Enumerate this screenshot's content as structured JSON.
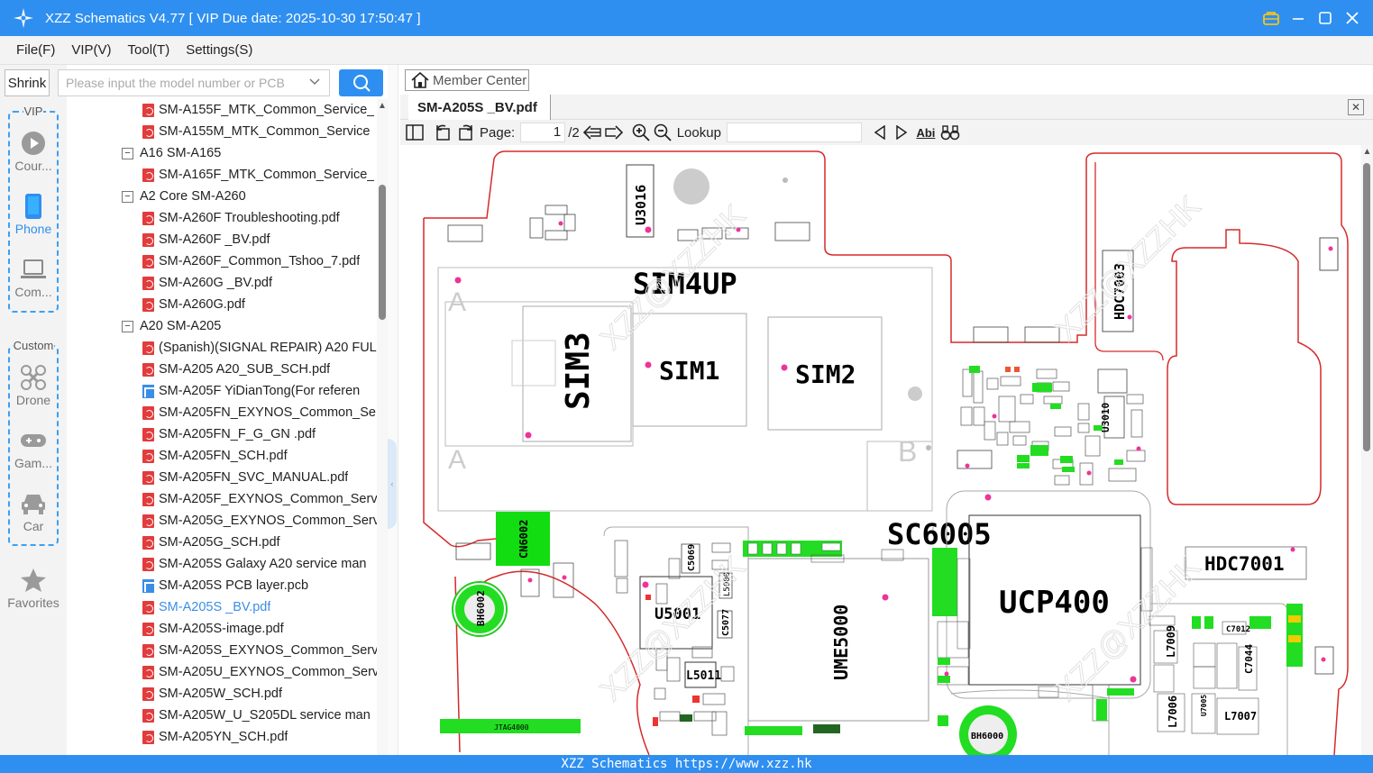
{
  "window": {
    "title": "XZZ Schematics V4.77 [ VIP Due date: 2025-10-30 17:50:47 ]"
  },
  "menu": [
    "File(F)",
    "VIP(V)",
    "Tool(T)",
    "Settings(S)"
  ],
  "left_rail": {
    "shrink_label": "Shrink",
    "vip_group_label": "VIP",
    "custom_group_label": "Custom",
    "items": [
      {
        "label": "Cour...",
        "icon": "play-icon"
      },
      {
        "label": "Phone",
        "icon": "phone-icon",
        "active": true
      },
      {
        "label": "Com...",
        "icon": "laptop-icon"
      },
      {
        "label": "Drone",
        "icon": "drone-icon"
      },
      {
        "label": "Gam...",
        "icon": "gamepad-icon"
      },
      {
        "label": "Car",
        "icon": "car-icon"
      },
      {
        "label": "Favorites",
        "icon": "star-icon"
      }
    ]
  },
  "search": {
    "placeholder": "Please input the model number or PCB"
  },
  "tree": [
    {
      "type": "pdf",
      "label": "SM-A155F_MTK_Common_Service_"
    },
    {
      "type": "pdf",
      "label": "SM-A155M_MTK_Common_Service"
    },
    {
      "type": "folder",
      "label": "A16 SM-A165"
    },
    {
      "type": "pdf",
      "label": "SM-A165F_MTK_Common_Service_"
    },
    {
      "type": "folder",
      "label": "A2 Core SM-A260"
    },
    {
      "type": "pdf",
      "label": "SM-A260F  Troubleshooting.pdf"
    },
    {
      "type": "pdf",
      "label": "SM-A260F _BV.pdf"
    },
    {
      "type": "pdf",
      "label": "SM-A260F_Common_Tshoo_7.pdf"
    },
    {
      "type": "pdf",
      "label": "SM-A260G _BV.pdf"
    },
    {
      "type": "pdf",
      "label": "SM-A260G.pdf"
    },
    {
      "type": "folder",
      "label": "A20 SM-A205"
    },
    {
      "type": "pdf",
      "label": "(Spanish)(SIGNAL REPAIR) A20 FUL"
    },
    {
      "type": "pdf",
      "label": "SM-A205 A20_SUB_SCH.pdf"
    },
    {
      "type": "pcb",
      "label": "SM-A205F YiDianTong(For referen"
    },
    {
      "type": "pdf",
      "label": "SM-A205FN_EXYNOS_Common_Se"
    },
    {
      "type": "pdf",
      "label": "SM-A205FN_F_G_GN .pdf"
    },
    {
      "type": "pdf",
      "label": "SM-A205FN_SCH.pdf"
    },
    {
      "type": "pdf",
      "label": "SM-A205FN_SVC_MANUAL.pdf"
    },
    {
      "type": "pdf",
      "label": "SM-A205F_EXYNOS_Common_Serv"
    },
    {
      "type": "pdf",
      "label": "SM-A205G_EXYNOS_Common_Serv"
    },
    {
      "type": "pdf",
      "label": "SM-A205G_SCH.pdf"
    },
    {
      "type": "pdf",
      "label": "SM-A205S Galaxy A20 service man"
    },
    {
      "type": "pcb",
      "label": "SM-A205S PCB layer.pcb"
    },
    {
      "type": "pdf",
      "label": "SM-A205S _BV.pdf",
      "selected": true
    },
    {
      "type": "pdf",
      "label": "SM-A205S-image.pdf"
    },
    {
      "type": "pdf",
      "label": "SM-A205S_EXYNOS_Common_Serv"
    },
    {
      "type": "pdf",
      "label": "SM-A205U_EXYNOS_Common_Serv"
    },
    {
      "type": "pdf",
      "label": "SM-A205W_SCH.pdf"
    },
    {
      "type": "pdf",
      "label": "SM-A205W_U_S205DL service man"
    },
    {
      "type": "pdf",
      "label": "SM-A205YN_SCH.pdf"
    }
  ],
  "viewer": {
    "member_center": "Member Center",
    "tab_title": "SM-A205S _BV.pdf",
    "page_label": "Page:",
    "page_current": "1",
    "page_total": "/2",
    "lookup_label": "Lookup",
    "abi_label": "Abi"
  },
  "board_labels": {
    "sim4up": "SIM4UP",
    "sim3": "SIM3",
    "sim1": "SIM1",
    "sim2": "SIM2",
    "sc6005": "SC6005",
    "ucp400": "UCP400",
    "u5001": "U5001",
    "ume5000": "UME5000",
    "l5011": "L5011",
    "hdc7001": "HDC7001",
    "hdc7003": "HDC7003",
    "u3016": "U3016",
    "u3010": "U3010",
    "bh6002": "BH6002",
    "bh6000": "BH6000",
    "cn6002": "CN6002",
    "l7009": "L7009",
    "l7006": "L7006",
    "l7007": "L7007",
    "c7044": "C7044",
    "c5069": "C5069",
    "c5077": "C5077",
    "l5000": "L5000",
    "c7012": "C7012",
    "u7005": "U7005",
    "jtag": "JTAG4000",
    "a_top": "A",
    "a_bot": "A",
    "b": "B"
  },
  "status_text": "XZZ Schematics https://www.xzz.hk"
}
